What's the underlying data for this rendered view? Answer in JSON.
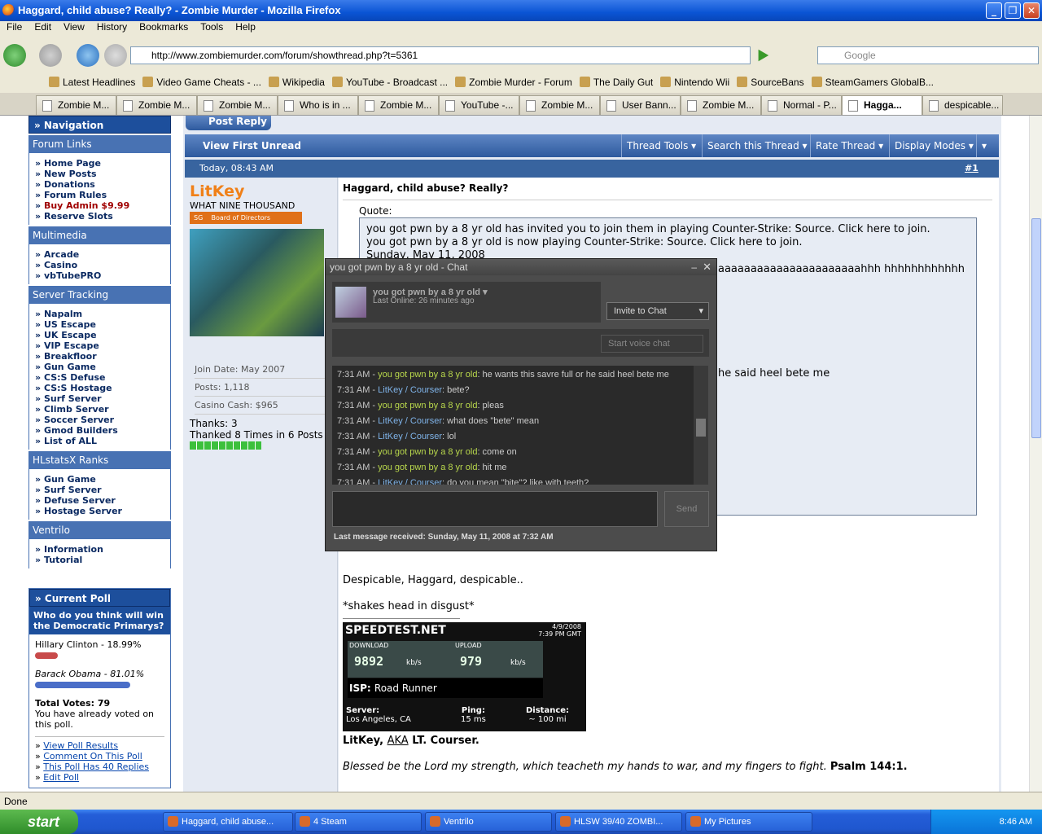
{
  "window": {
    "title": "Haggard, child abuse? Really? - Zombie Murder - Mozilla Firefox"
  },
  "menu": [
    "File",
    "Edit",
    "View",
    "History",
    "Bookmarks",
    "Tools",
    "Help"
  ],
  "nav": {
    "url": "http://www.zombiemurder.com/forum/showthread.php?t=5361",
    "search_placeholder": "Google"
  },
  "bookmarks": [
    "Latest Headlines",
    "Video Game Cheats - ...",
    "Wikipedia",
    "YouTube - Broadcast ...",
    "Zombie Murder - Forum",
    "The Daily Gut",
    "Nintendo Wii",
    "SourceBans",
    "SteamGamers GlobalB..."
  ],
  "tabs": [
    "Zombie M...",
    "Zombie M...",
    "Zombie M...",
    "Who is in ...",
    "Zombie M...",
    "YouTube -...",
    "Zombie M...",
    "User Bann...",
    "Zombie M...",
    "Normal - P...",
    "Hagga...",
    "despicable..."
  ],
  "sidebar": {
    "nav_title": "» Navigation",
    "sections": [
      {
        "title": "Forum Links",
        "items": [
          "Home Page",
          "New Posts",
          "Donations",
          "Forum Rules",
          "Buy Admin $9.99",
          "Reserve Slots"
        ]
      },
      {
        "title": "Multimedia",
        "items": [
          "Arcade",
          "Casino",
          "vbTubePRO"
        ]
      },
      {
        "title": "Server Tracking",
        "items": [
          "Napalm",
          "US Escape",
          "UK Escape",
          "VIP Escape",
          "Breakfloor",
          "Gun Game",
          "CS:S Defuse",
          "CS:S Hostage",
          "Surf Server",
          "Climb Server",
          "Soccer Server",
          "Gmod Builders",
          "List of ALL"
        ]
      },
      {
        "title": "HLstatsX Ranks",
        "items": [
          "Gun Game",
          "Surf Server",
          "Defuse Server",
          "Hostage Server"
        ]
      },
      {
        "title": "Ventrilo",
        "items": [
          "Information",
          "Tutorial"
        ]
      }
    ],
    "poll": {
      "title": "» Current Poll",
      "question": "Who do you think will win the Democratic Primarys?",
      "options": [
        {
          "label": "Hillary Clinton - 18.99%",
          "value": 18.99,
          "color": "#c84a4a"
        },
        {
          "label": "Barack Obama - 81.01%",
          "value": 81.01,
          "color": "#4a6ec8"
        }
      ],
      "total": "Total Votes: 79",
      "voted": "You have already voted on this poll.",
      "links": [
        "View Poll Results",
        "Comment On This Poll",
        "This Poll Has 40 Replies",
        "Edit Poll"
      ]
    }
  },
  "thread": {
    "post_reply": "Post Reply",
    "view_first_unread": "View First Unread",
    "tools": [
      "Thread Tools",
      "Search this Thread",
      "Rate Thread",
      "Display Modes"
    ],
    "date": "Today, 08:43 AM",
    "post_no": "#1",
    "user": {
      "name": "LitKey",
      "title": "WHAT NINE THOUSAND",
      "badge": "Board of Directors",
      "badge_tag": "SG",
      "join": "Join Date: May 2007",
      "posts": "Posts: 1,118",
      "cash": "Casino Cash: $965",
      "thanks": "Thanks: 3",
      "thanked": "Thanked 8 Times in 6 Posts"
    },
    "post_title": "Haggard, child abuse? Really?",
    "quote_label": "Quote:",
    "quote_lines": [
      "you got pwn by a 8 yr old has invited you to join them in playing Counter-Strike: Source. Click here to join.",
      "you got pwn by a 8 yr old is now playing Counter-Strike: Source. Click here to join.",
      "Sunday, May 11, 2008"
    ],
    "quote_overflow1": "aaaaaaaaaaaaaaaaaaaaaahhh hhhhhhhhhhhh",
    "quote_overflow2": "he said heel bete me",
    "body1": "Despicable, Haggard, despicable..",
    "body2": "*shakes head in disgust*",
    "sig_name": "LitKey,",
    "sig_aka": "AKA",
    "sig_rest": "LT. Courser.",
    "sig_verse": "Blessed be the Lord my strength, which teacheth my hands to war, and my fingers to fight.",
    "sig_ref": "Psalm 144:1.",
    "speedtest": {
      "brand": "SPEEDTEST.NET",
      "date": "4/9/2008",
      "time": "7:39 PM GMT",
      "download_label": "DOWNLOAD",
      "upload_label": "UPLOAD",
      "download": "9892",
      "upload": "979",
      "unit": "kb/s",
      "isp_label": "ISP:",
      "isp": "Road Runner",
      "server_label": "Server:",
      "server": "Los Angeles, CA",
      "ping_label": "Ping:",
      "ping": "15 ms",
      "distance_label": "Distance:",
      "distance": "~ 100 mi"
    }
  },
  "chat": {
    "title": "you got pwn by a 8 yr old - Chat",
    "friend_name": "you got pwn by a 8 yr old",
    "last_online": "Last Online: 26 minutes ago",
    "invite": "Invite to Chat",
    "voice": "Start voice chat",
    "send": "Send",
    "footer": "Last message received: Sunday, May 11, 2008 at 7:32 AM",
    "messages": [
      {
        "time": "7:31 AM - ",
        "who": "you got pwn by a 8 yr old",
        "side": "g",
        "text": ": he wants this savre full or he said heel bete me"
      },
      {
        "time": "7:31 AM - ",
        "who": "LitKey / Courser",
        "side": "b",
        "text": ": bete?"
      },
      {
        "time": "7:31 AM - ",
        "who": "you got pwn by a 8 yr old",
        "side": "g",
        "text": ": pleas"
      },
      {
        "time": "7:31 AM - ",
        "who": "LitKey / Courser",
        "side": "b",
        "text": ": what does \"bete\" mean"
      },
      {
        "time": "7:31 AM - ",
        "who": "LitKey / Courser",
        "side": "b",
        "text": ": lol"
      },
      {
        "time": "7:31 AM - ",
        "who": "you got pwn by a 8 yr old",
        "side": "g",
        "text": ": come on"
      },
      {
        "time": "7:31 AM - ",
        "who": "you got pwn by a 8 yr old",
        "side": "g",
        "text": ": hit me"
      },
      {
        "time": "7:31 AM - ",
        "who": "LitKey / Courser",
        "side": "b",
        "text": ": do you mean \"bite\"? like with teeth?"
      }
    ]
  },
  "status": "Done",
  "taskbar": {
    "start": "start",
    "tasks": [
      "Haggard, child abuse...",
      "4 Steam",
      "Ventrilo",
      "HLSW   39/40 ZOMBI...",
      "My Pictures"
    ],
    "clock": "8:46 AM"
  }
}
